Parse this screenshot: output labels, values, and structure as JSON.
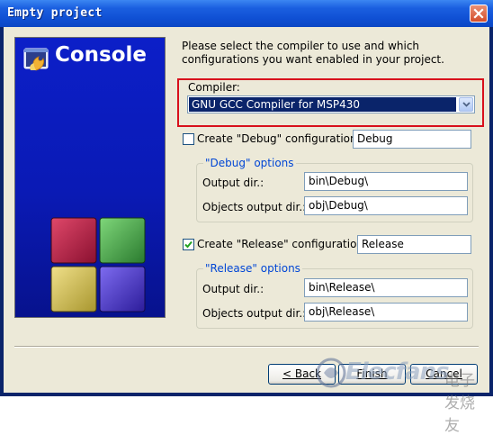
{
  "window": {
    "title": "Empty project",
    "close_symbol": "✕"
  },
  "banner": {
    "title": "Console"
  },
  "instructions": "Please select the compiler to use and which configurations you want enabled in your project.",
  "compiler": {
    "label": "Compiler:",
    "selected": "GNU GCC Compiler for MSP430"
  },
  "debug": {
    "checkbox_label": "Create \"Debug\" configuration:",
    "checked": false,
    "name_value": "Debug",
    "group_title": "\"Debug\" options",
    "output_dir_label": "Output dir.:",
    "output_dir_value": "bin\\Debug\\",
    "objects_dir_label": "Objects output dir.:",
    "objects_dir_value": "obj\\Debug\\"
  },
  "release": {
    "checkbox_label": "Create \"Release\" configuration:",
    "checked": true,
    "name_value": "Release",
    "group_title": "\"Release\" options",
    "output_dir_label": "Output dir.:",
    "output_dir_value": "bin\\Release\\",
    "objects_dir_label": "Objects output dir.:",
    "objects_dir_value": "obj\\Release\\"
  },
  "buttons": {
    "back": "< Back",
    "finish": "Finish",
    "cancel": "Cancel"
  },
  "watermark": {
    "brand": "Elecfans",
    "cn": "电子发烧友"
  },
  "colors": {
    "highlight_border": "#d8101c",
    "selection_bg": "#0a246a",
    "banner_blue": "#0a1ab5",
    "group_legend": "#0046d5"
  }
}
